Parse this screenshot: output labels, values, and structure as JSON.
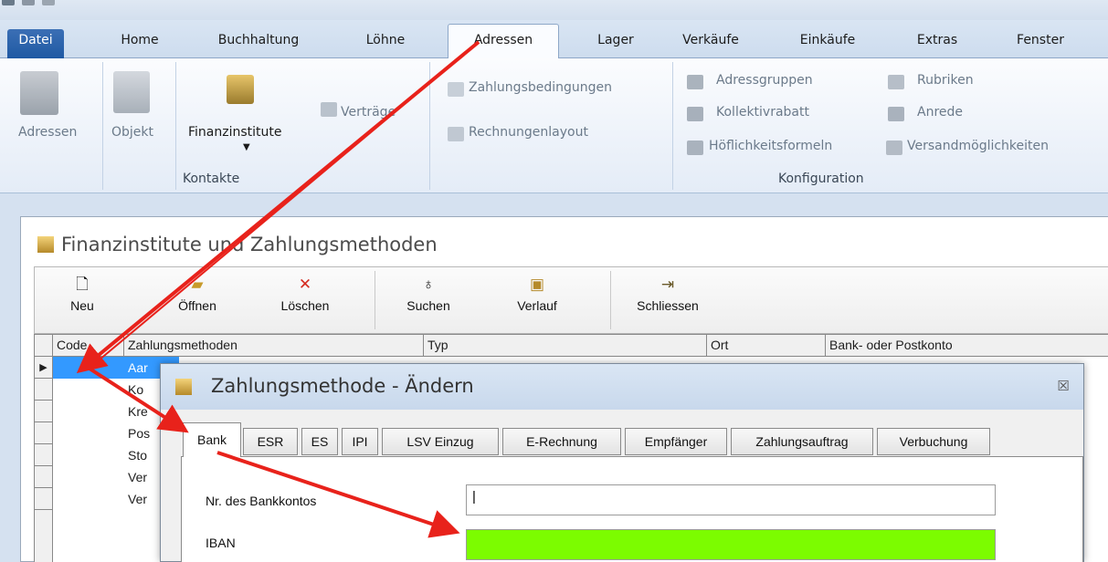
{
  "ribbon_tabs": [
    "Datei",
    "Home",
    "Buchhaltung",
    "Löhne",
    "Adressen",
    "Lager",
    "Verkäufe",
    "Einkäufe",
    "Extras",
    "Fenster"
  ],
  "ribbon": {
    "adressen": "Adressen",
    "objekt": "Objekt",
    "finanzinstitute": "Finanzinstitute",
    "vertraege": "Verträge",
    "kontakte_caption": "Kontakte",
    "zahlungsbedingungen": "Zahlungsbedingungen",
    "rechnungenlayout": "Rechnungenlayout",
    "adressgruppen": "Adressgruppen",
    "kollektivrabatt": "Kollektivrabatt",
    "hoeflichkeitsformeln": "Höflichkeitsformeln",
    "rubriken": "Rubriken",
    "anrede": "Anrede",
    "versandmoeglichkeiten": "Versandmöglichkeiten",
    "konfiguration_caption": "Konfiguration"
  },
  "window": {
    "title": "Finanzinstitute und Zahlungsmethoden",
    "toolbar": {
      "neu": "Neu",
      "oeffnen": "Öffnen",
      "loeschen": "Löschen",
      "suchen": "Suchen",
      "verlauf": "Verlauf",
      "schliessen": "Schliessen"
    },
    "columns": [
      "Code",
      "Zahlungsmethoden",
      "Typ",
      "Ort",
      "Bank- oder Postkonto"
    ],
    "rows": [
      "Aar",
      "Ko",
      "Kre",
      "Pos",
      "Sto",
      "Ver",
      "Ver"
    ]
  },
  "dialog": {
    "title": "Zahlungsmethode - Ändern",
    "close_glyph": "☒",
    "tabs": [
      "Bank",
      "ESR",
      "ES",
      "IPI",
      "LSV Einzug",
      "E-Rechnung",
      "Empfänger",
      "Zahlungsauftrag",
      "Verbuchung"
    ],
    "fields": {
      "bankkonto_label": "Nr. des Bankkontos",
      "bankkonto_value": "|",
      "iban_label": "IBAN",
      "iban_value": ""
    }
  },
  "colors": {
    "annotation_arrow": "#e8221b",
    "iban_highlight": "#7cfc00",
    "file_tab": "#2a62ad"
  }
}
